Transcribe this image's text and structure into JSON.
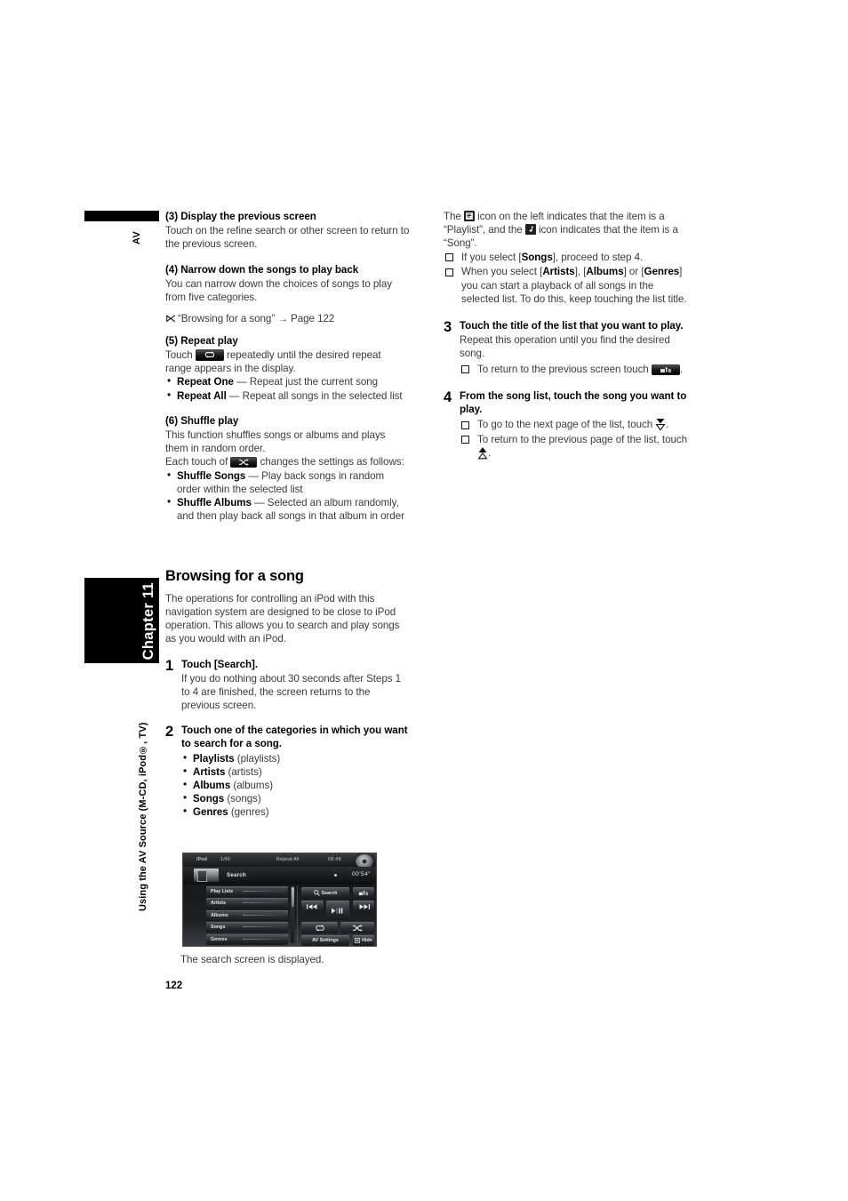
{
  "page": {
    "number": "122",
    "chapter_tab": "Chapter 11",
    "side_tab": "Using the AV Source (M-CD, iPod®, TV)",
    "av_tab": "AV"
  },
  "left_column": {
    "item3": {
      "heading": "(3) Display the previous screen",
      "body": "Touch on the refine search or other screen to return to the previous screen."
    },
    "item4": {
      "heading": "(4) Narrow down the songs to play back",
      "body": "You can narrow down the choices of songs to play from five categories.",
      "reference": "“Browsing for a song” → Page 122"
    },
    "item5": {
      "heading": "(5) Repeat play",
      "body_before": "Touch",
      "body_after": "repeatedly until the desired repeat range appears in the display.",
      "bullets": [
        {
          "term": "Repeat One",
          "desc": " — Repeat just the current song"
        },
        {
          "term": "Repeat All",
          "desc": " — Repeat all songs in the selected list"
        }
      ]
    },
    "item6": {
      "heading": "(6) Shuffle play",
      "body": "This function shuffles songs or albums and plays them in random order.",
      "body_before": "Each touch of",
      "body_after": "changes the settings as follows:",
      "bullets": [
        {
          "term": "Shuffle Songs",
          "desc": " — Play back songs in random order within the selected list"
        },
        {
          "term": "Shuffle Albums",
          "desc": " — Selected an album randomly, and then play back all songs in that album in order"
        }
      ]
    },
    "section": {
      "title": "Browsing for a song",
      "intro": "The operations for controlling an iPod with this navigation system are designed to be close to iPod operation. This allows you to search and play songs as you would with an iPod."
    },
    "step1": {
      "num": "1",
      "title": "Touch [Search].",
      "body": "If you do nothing about 30 seconds after Steps 1 to 4 are finished, the screen returns to the previous screen."
    },
    "step2": {
      "num": "2",
      "title": "Touch one of the categories in which you want to search for a song.",
      "bullets": [
        {
          "term": "Playlists",
          "desc": " (playlists)"
        },
        {
          "term": "Artists",
          "desc": " (artists)"
        },
        {
          "term": "Albums",
          "desc": " (albums)"
        },
        {
          "term": "Songs",
          "desc": " (songs)"
        },
        {
          "term": "Genres",
          "desc": " (genres)"
        }
      ]
    },
    "screenshot_caption": "The search screen is displayed."
  },
  "right_column": {
    "intro": {
      "part1": "The",
      "part2": "icon on the left indicates that the item is a “Playlist”, and the",
      "part3": "icon indicates that the item is a “Song”."
    },
    "notes": [
      {
        "pre": "If you select [",
        "b1": "Songs",
        "post": "], proceed to step 4."
      },
      {
        "pre": "When you select [",
        "b1": "Artists",
        "mid1": "], [",
        "b2": "Albums",
        "mid2": "] or [",
        "b3": "Genres",
        "post": "] you can start a playback of all songs in the selected list. To do this, keep touching the list title."
      }
    ],
    "step3": {
      "num": "3",
      "title": "Touch the title of the list that you want to play.",
      "body": "Repeat this operation until you find the desired song.",
      "note_before": "To return to the previous screen touch",
      "note_after": "."
    },
    "step4": {
      "num": "4",
      "title": "From the song list, touch the song you want to play.",
      "note1_before": "To go to the next page of the list, touch",
      "note1_after": ".",
      "note2_before": "To return to the previous page of the list, touch",
      "note2_after": "."
    }
  },
  "device_screenshot": {
    "status": {
      "source": "iPod",
      "track": "1/40",
      "repeat": "Repeat All",
      "clock": "08:48"
    },
    "title_bar": {
      "title": "Search",
      "elapsed": "00'54\""
    },
    "list_items": [
      "Play Lists",
      "Artists",
      "Albums",
      "Songs",
      "Genres"
    ],
    "buttons": {
      "search": "Search",
      "return": "return-icon",
      "prev": "prev-track-icon",
      "play": "play-pause-icon",
      "next": "next-track-icon",
      "repeat": "repeat-icon",
      "shuffle": "shuffle-icon",
      "av_settings": "AV Settings",
      "hide": "Hide"
    }
  }
}
